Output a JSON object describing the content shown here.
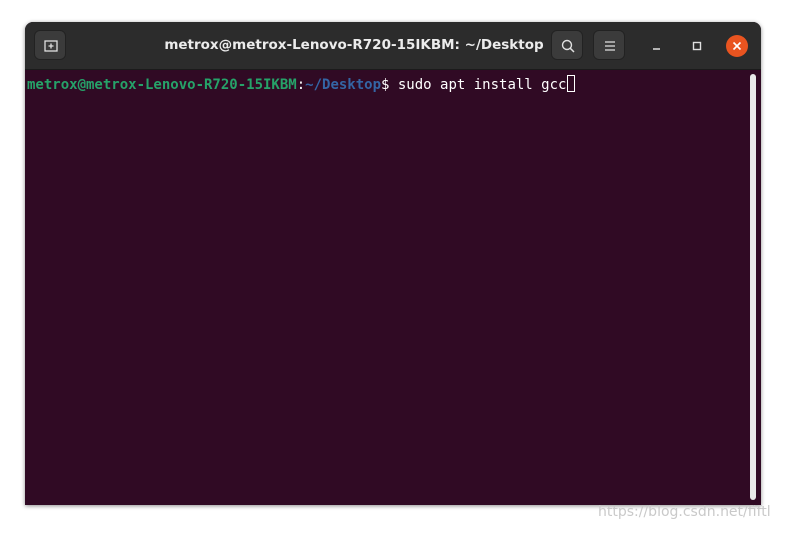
{
  "window": {
    "title": "metrox@metrox-Lenovo-R720-15IKBM: ~/Desktop"
  },
  "terminal": {
    "prompt_user": "metrox@metrox-Lenovo-R720-15IKBM",
    "prompt_sep": ":",
    "prompt_path": "~/Desktop",
    "prompt_symbol": "$ ",
    "command": "sudo apt install gcc",
    "colors": {
      "background": "#300a24",
      "user": "#26a269",
      "path": "#3465a4",
      "text": "#ffffff"
    }
  },
  "titlebar_buttons": {
    "new_tab_icon": "new-tab-icon",
    "search_icon": "search-icon",
    "menu_icon": "hamburger-menu-icon",
    "minimize_icon": "minimize-icon",
    "maximize_icon": "maximize-icon",
    "close_icon": "close-icon",
    "close_color": "#e95420"
  },
  "watermark": {
    "text": "https://blog.csdn.net/fiftl"
  }
}
